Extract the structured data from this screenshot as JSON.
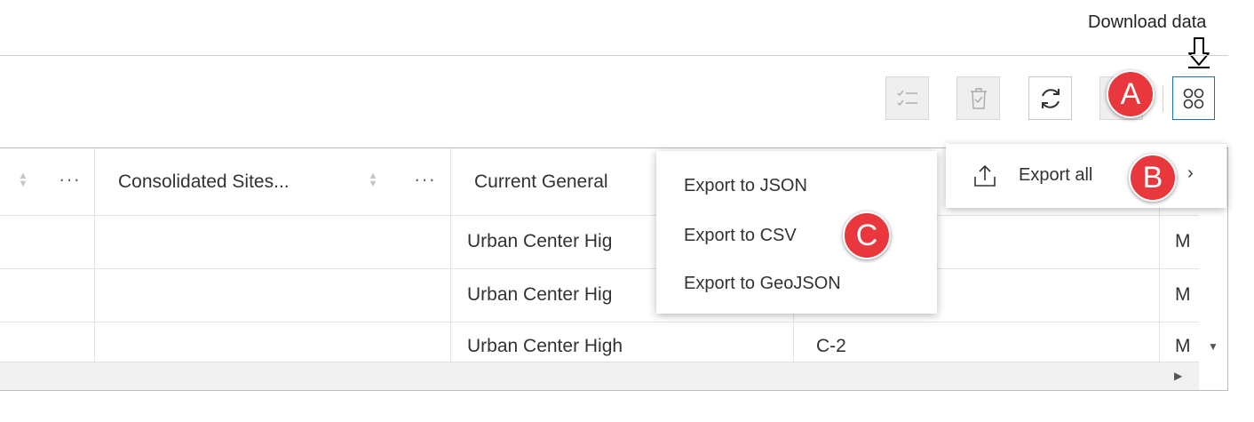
{
  "annotation": {
    "caption": "Download data",
    "badges": {
      "a": "A",
      "b": "B",
      "c": "C"
    }
  },
  "toolbar": {
    "buttons": [
      {
        "name": "show-selection-button",
        "icon": "checklist-icon",
        "disabled": true
      },
      {
        "name": "delete-selection-button",
        "icon": "trash-icon",
        "disabled": true
      },
      {
        "name": "refresh-button",
        "icon": "refresh-icon",
        "disabled": false
      },
      {
        "name": "hidden-button",
        "icon": "",
        "disabled": true
      },
      {
        "name": "more-actions-button",
        "icon": "grid-circles-icon",
        "disabled": false,
        "active": true
      }
    ]
  },
  "table": {
    "columns": [
      "Consolidated Sites...",
      "Current General"
    ],
    "rows": [
      {
        "general": "Urban Center Hig",
        "zoning": "",
        "last": "M"
      },
      {
        "general": "Urban Center Hig",
        "zoning": "",
        "last": "M"
      },
      {
        "general": "Urban Center High",
        "zoning": "C-2",
        "last": "M"
      }
    ]
  },
  "export_menu": {
    "label": "Export all",
    "icon": "upload-icon",
    "submenu": [
      "Export to JSON",
      "Export to CSV",
      "Export to GeoJSON"
    ]
  },
  "colors": {
    "accent": "#1f6fb3",
    "badge": "#e8383d"
  }
}
